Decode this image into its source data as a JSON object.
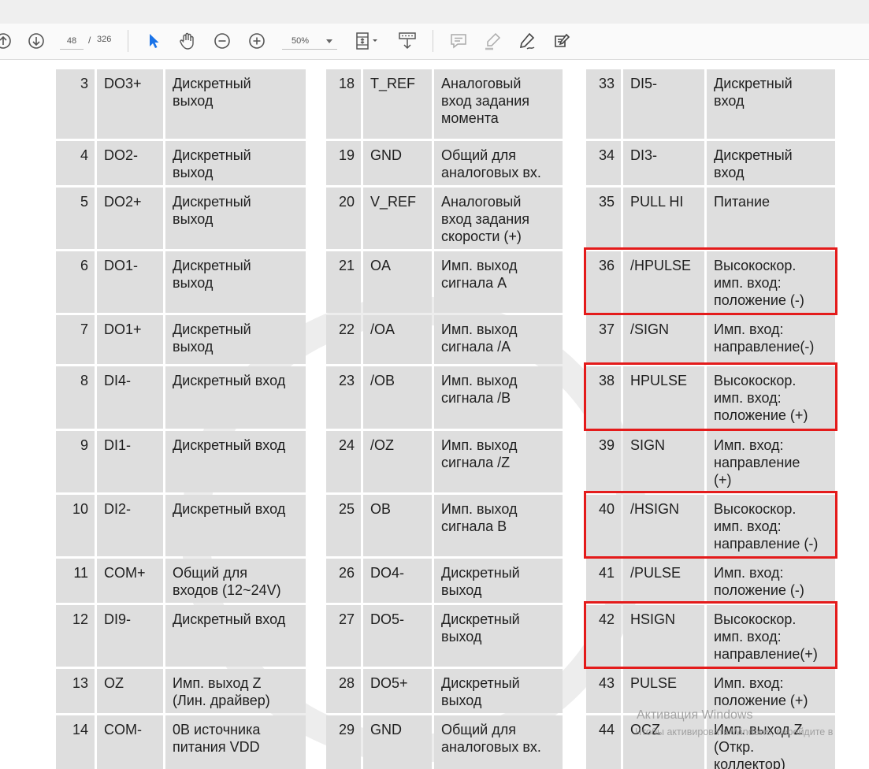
{
  "toolbar": {
    "page_current": "48",
    "page_separator": "/",
    "page_total": "326",
    "zoom": "50%"
  },
  "tables": [
    {
      "rows": [
        {
          "num": "3",
          "name": "DO3+",
          "desc": "Дискретный\nвыход"
        },
        {
          "num": "4",
          "name": "DO2-",
          "desc": "Дискретный\nвыход"
        },
        {
          "num": "5",
          "name": "DO2+",
          "desc": "Дискретный\nвыход"
        },
        {
          "num": "6",
          "name": "DO1-",
          "desc": "Дискретный\nвыход"
        },
        {
          "num": "7",
          "name": "DO1+",
          "desc": "Дискретный\nвыход"
        },
        {
          "num": "8",
          "name": "DI4-",
          "desc": "Дискретный вход"
        },
        {
          "num": "9",
          "name": "DI1-",
          "desc": "Дискретный вход"
        },
        {
          "num": "10",
          "name": "DI2-",
          "desc": "Дискретный вход"
        },
        {
          "num": "11",
          "name": "COM+",
          "desc": "Общий для\nвходов (12~24V)"
        },
        {
          "num": "12",
          "name": "DI9-",
          "desc": "Дискретный вход"
        },
        {
          "num": "13",
          "name": "OZ",
          "desc": "Имп. выход Z\n(Лин. драйвер)"
        },
        {
          "num": "14",
          "name": "COM-",
          "desc": "0В источника\nпитания VDD"
        }
      ]
    },
    {
      "rows": [
        {
          "num": "18",
          "name": "T_REF",
          "desc": "Аналоговый\nвход задания\nмомента"
        },
        {
          "num": "19",
          "name": "GND",
          "desc": "Общий для\nаналоговых вх."
        },
        {
          "num": "20",
          "name": "V_REF",
          "desc": "Аналоговый\nвход задания\nскорости (+)"
        },
        {
          "num": "21",
          "name": "OA",
          "desc": "Имп.  выход\nсигнала  A"
        },
        {
          "num": "22",
          "name": "/OA",
          "desc": "Имп.  выход\nсигнала  /A"
        },
        {
          "num": "23",
          "name": "/OB",
          "desc": "Имп.  выход\nсигнала  /B"
        },
        {
          "num": "24",
          "name": "/OZ",
          "desc": "Имп.  выход\nсигнала  /Z"
        },
        {
          "num": "25",
          "name": "OB",
          "desc": "Имп.  выход\nсигнала  B"
        },
        {
          "num": "26",
          "name": "DO4-",
          "desc": "Дискретный\nвыход"
        },
        {
          "num": "27",
          "name": "DO5-",
          "desc": "Дискретный\nвыход"
        },
        {
          "num": "28",
          "name": "DO5+",
          "desc": "Дискретный\nвыход"
        },
        {
          "num": "29",
          "name": "GND",
          "desc": "Общий для\nаналоговых вх."
        }
      ]
    },
    {
      "rows": [
        {
          "num": "33",
          "name": "DI5-",
          "desc": "Дискретный\nвход"
        },
        {
          "num": "34",
          "name": "DI3-",
          "desc": "Дискретный\nвход"
        },
        {
          "num": "35",
          "name": "PULL HI",
          "desc": "Питание"
        },
        {
          "num": "36",
          "name": "/HPULSE",
          "desc": "Высокоскор.\nимп. вход:\nположение (-)"
        },
        {
          "num": "37",
          "name": "/SIGN",
          "desc": "Имп. вход:\nнаправление(-)"
        },
        {
          "num": "38",
          "name": "HPULSE",
          "desc": "Высокоскор.\nимп. вход:\nположение (+)"
        },
        {
          "num": "39",
          "name": "SIGN",
          "desc": "Имп. вход:\nнаправление\n(+)"
        },
        {
          "num": "40",
          "name": "/HSIGN",
          "desc": "Высокоскор.\nимп. вход:\nнаправление (-)"
        },
        {
          "num": "41",
          "name": "/PULSE",
          "desc": "Имп. вход:\nположение (-)"
        },
        {
          "num": "42",
          "name": "HSIGN",
          "desc": "Высокоскор.\nимп. вход:\nнаправление(+)"
        },
        {
          "num": "43",
          "name": "PULSE",
          "desc": "Имп. вход:\nположение (+)"
        },
        {
          "num": "44",
          "name": "OCZ",
          "desc": "Имп. выход Z\n(Откр.\nколлектор)"
        }
      ]
    }
  ],
  "highlighted_pins": [
    "36",
    "38",
    "40",
    "42"
  ],
  "activation": {
    "title": "Активация Windows",
    "subtitle": "Чтобы активировать Windows, перейдите в"
  },
  "colors": {
    "highlight": "#e41b1b",
    "cell": "#dedede",
    "accent": "#1a73e8"
  }
}
